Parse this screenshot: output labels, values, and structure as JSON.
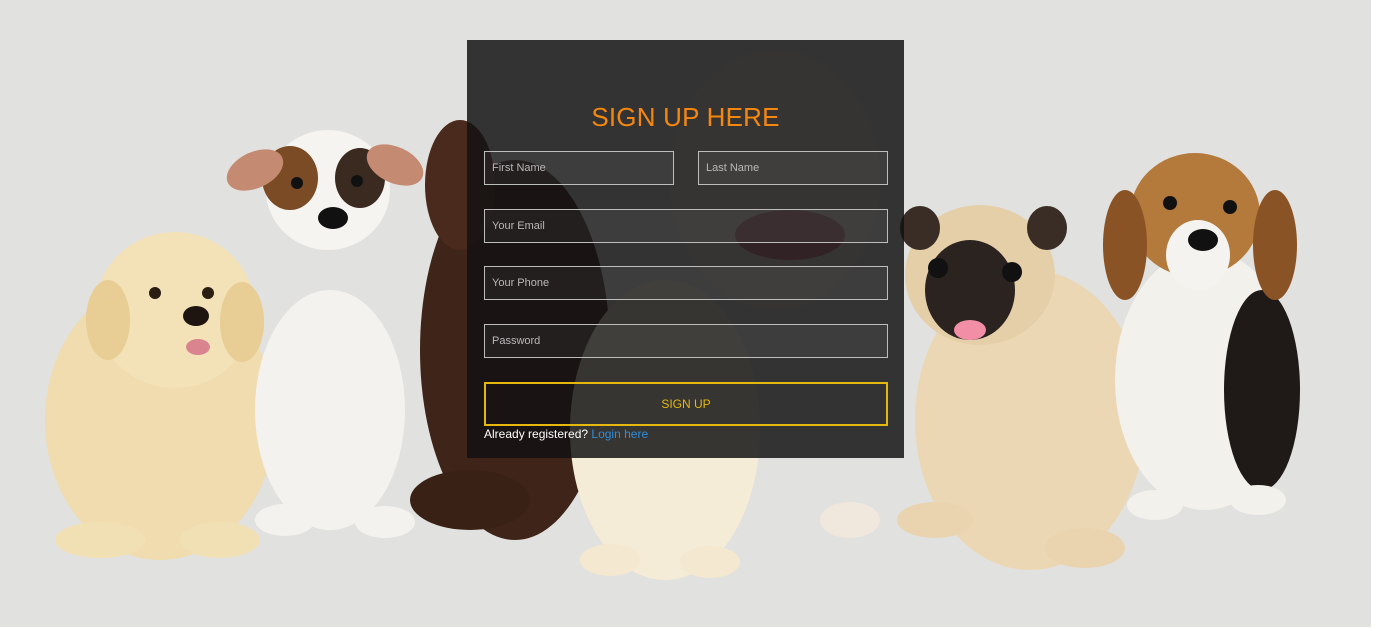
{
  "form": {
    "title": "SIGN UP HERE",
    "first_name_placeholder": "First Name",
    "last_name_placeholder": "Last Name",
    "email_placeholder": "Your Email",
    "phone_placeholder": "Your Phone",
    "password_placeholder": "Password",
    "submit_label": "SIGN UP",
    "already_text": "Already registered?",
    "login_link": "Login here"
  },
  "colors": {
    "title": "#f5870f",
    "button_border": "#e4b80e",
    "link": "#2f8ddb",
    "panel_bg": "rgba(18,18,18,0.84)",
    "page_bg": "#e1e1df"
  },
  "background": {
    "description_icons": [
      "golden-retriever-puppy",
      "jack-russell-puppy",
      "labrador-puppy",
      "bulldog-puppy",
      "retriever-puppy",
      "pug-puppy",
      "beagle-puppy"
    ]
  }
}
